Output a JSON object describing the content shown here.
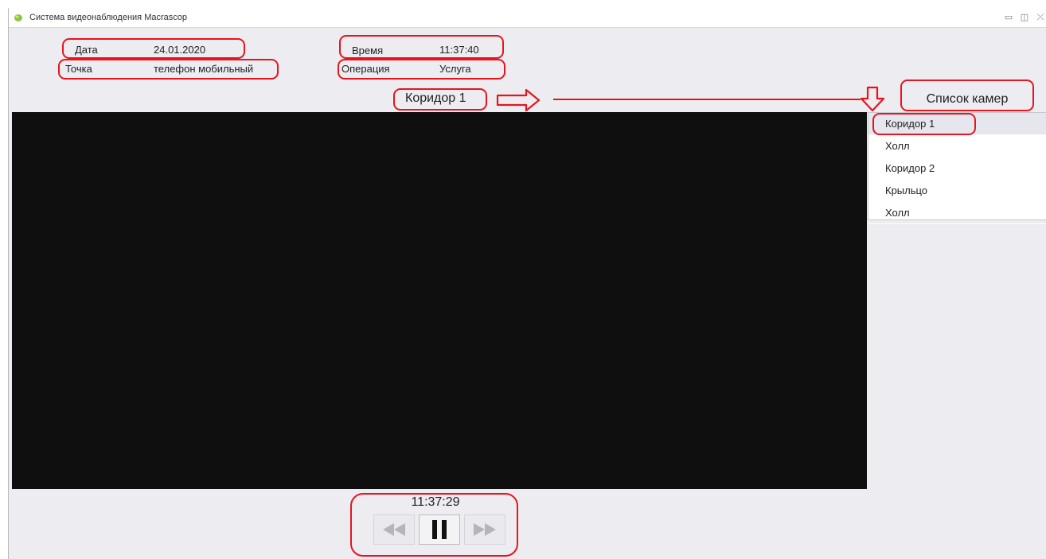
{
  "window": {
    "title": "Система видеонаблюдения Macrascop",
    "controls": {
      "minimize": "▭",
      "maximize": "◫",
      "close": "⤫"
    }
  },
  "info": {
    "date_label": "Дата",
    "date_value": "24.01.2020",
    "point_label": "Точка",
    "point_value": "телефон мобильный",
    "time_label": "Время",
    "time_value": "11:37:40",
    "operation_label": "Операция",
    "operation_value": "Услуга"
  },
  "camera": {
    "current_title": "Коридор 1",
    "list_button_label": "Список камер",
    "list": [
      "Коридор 1",
      "Холл",
      "Коридор 2",
      "Крыльцо",
      "Холл"
    ],
    "selected_index": 0
  },
  "player": {
    "timestamp": "11:37:29",
    "icons": [
      "rewind-icon",
      "pause-icon",
      "fast-forward-icon"
    ]
  },
  "colors": {
    "annotation_red": "#e8141d",
    "video_bg": "#0f0f10",
    "window_bg": "#ececf1"
  }
}
